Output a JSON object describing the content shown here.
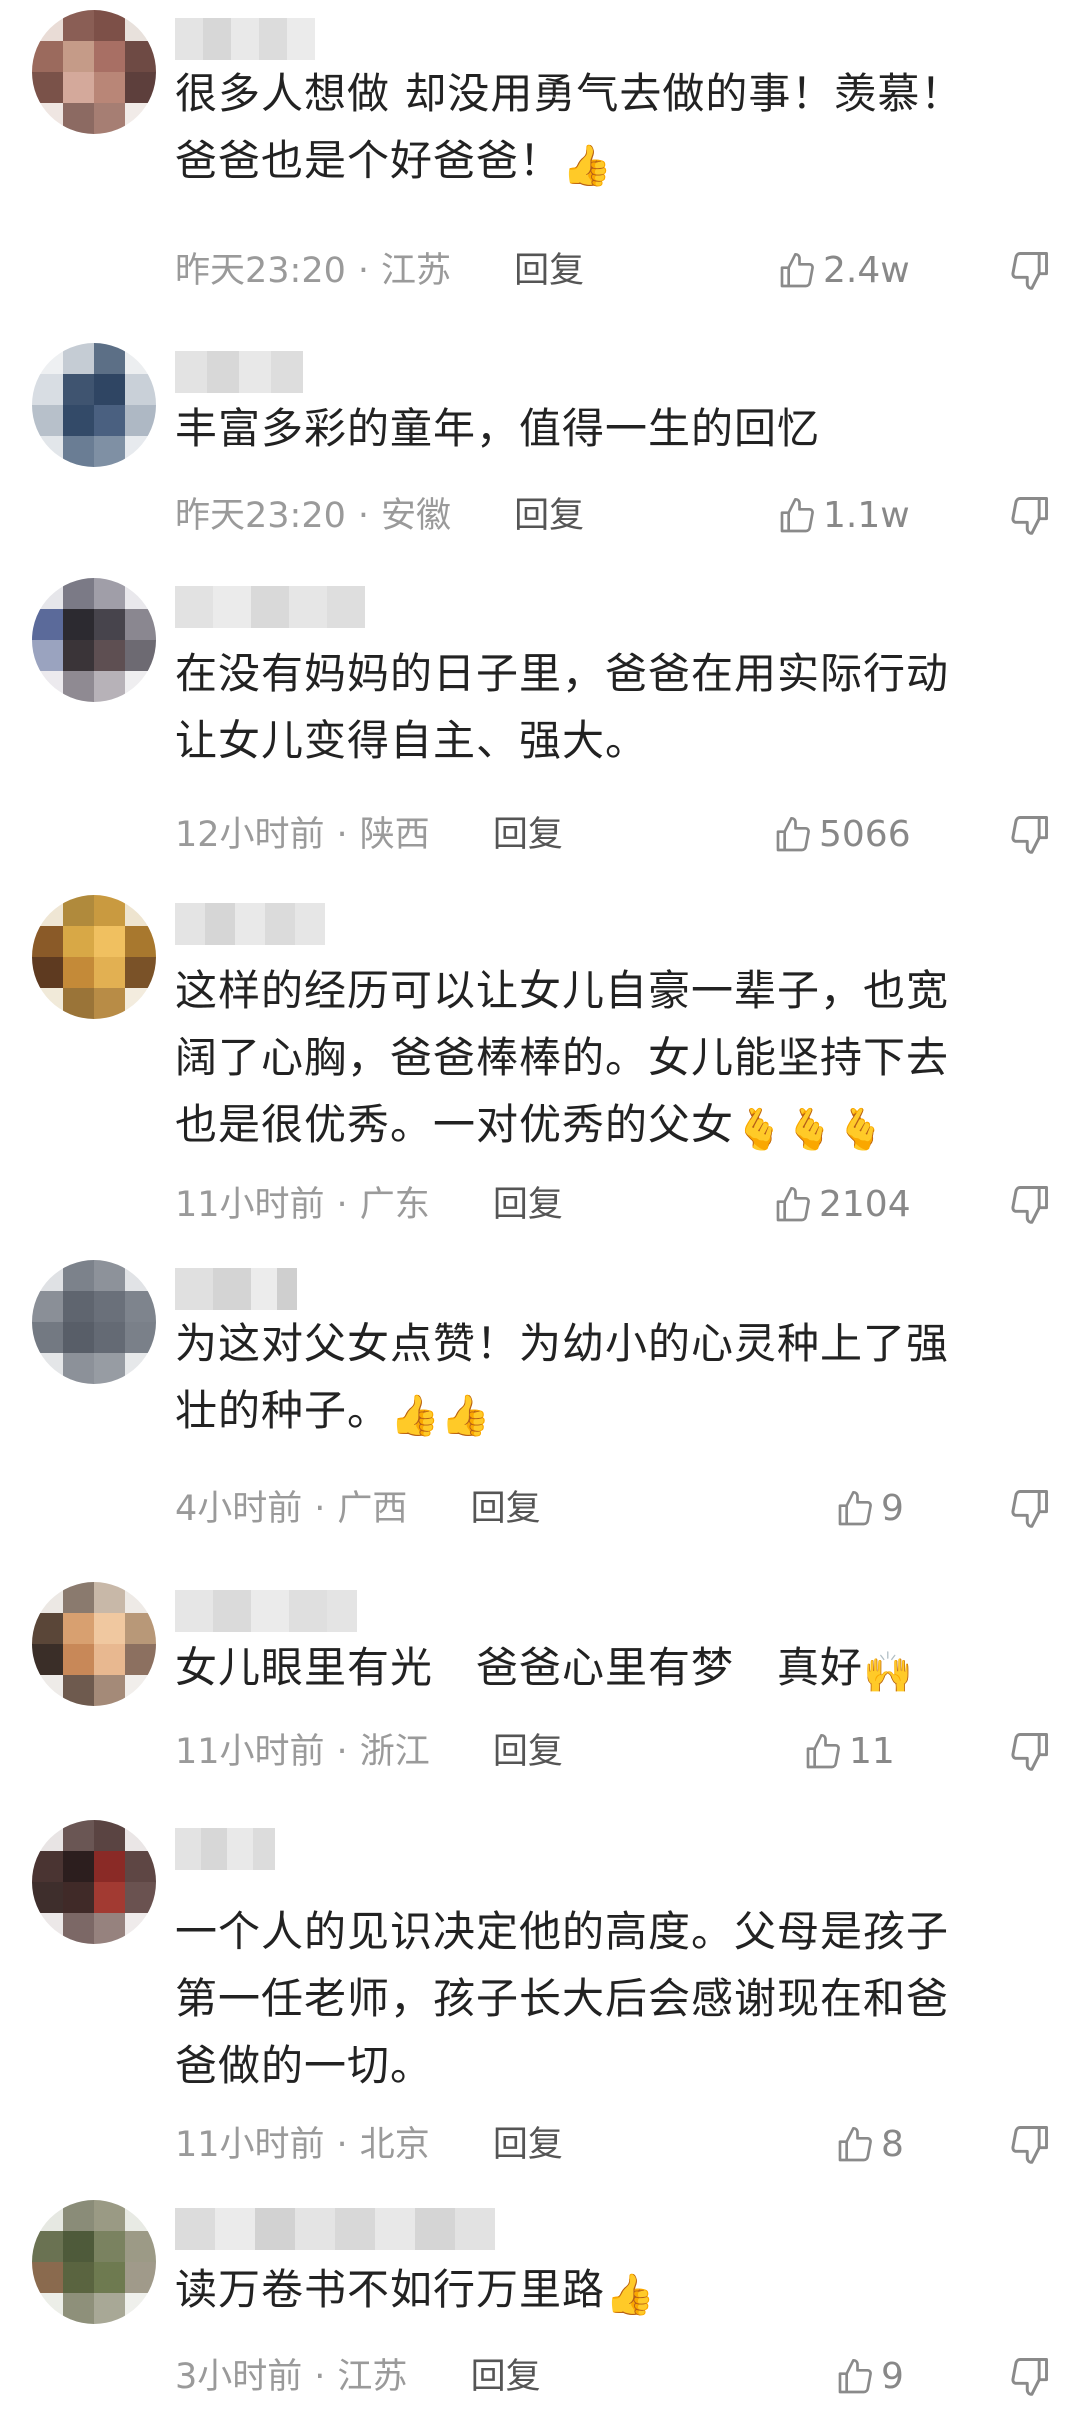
{
  "comments": [
    {
      "text_lines": [
        "很多人想做 却没用勇气去做的事！羡慕！",
        "爸爸也是个好爸爸！"
      ],
      "emoji": "👍",
      "time": "昨天23:20",
      "location": "江苏",
      "reply_label": "回复",
      "likes": "2.4w"
    },
    {
      "text_lines": [
        "丰富多彩的童年，值得一生的回忆"
      ],
      "emoji": "",
      "time": "昨天23:20",
      "location": "安徽",
      "reply_label": "回复",
      "likes": "1.1w"
    },
    {
      "text_lines": [
        "在没有妈妈的日子里，爸爸在用实际行动",
        "让女儿变得自主、强大。"
      ],
      "emoji": "",
      "time": "12小时前",
      "location": "陕西",
      "reply_label": "回复",
      "likes": "5066"
    },
    {
      "text_lines": [
        "这样的经历可以让女儿自豪一辈子，也宽",
        "阔了心胸，爸爸棒棒的。女儿能坚持下去",
        "也是很优秀。一对优秀的父女"
      ],
      "emoji": "🫰🫰🫰",
      "time": "11小时前",
      "location": "广东",
      "reply_label": "回复",
      "likes": "2104"
    },
    {
      "text_lines": [
        "为这对父女点赞！为幼小的心灵种上了强",
        "壮的种子。"
      ],
      "emoji": "👍👍",
      "time": "4小时前",
      "location": "广西",
      "reply_label": "回复",
      "likes": "9"
    },
    {
      "text_lines": [
        "女儿眼里有光　爸爸心里有梦　真好"
      ],
      "emoji": "🙌",
      "time": "11小时前",
      "location": "浙江",
      "reply_label": "回复",
      "likes": "11"
    },
    {
      "text_lines": [
        "一个人的见识决定他的高度。父母是孩子",
        "第一任老师，孩子长大后会感谢现在和爸",
        "爸做的一切。"
      ],
      "emoji": "",
      "time": "11小时前",
      "location": "北京",
      "reply_label": "回复",
      "likes": "8"
    },
    {
      "text_lines": [
        "读万卷书不如行万里路"
      ],
      "emoji": "👍",
      "time": "3小时前",
      "location": "江苏",
      "reply_label": "回复",
      "likes": "9"
    }
  ],
  "colors": {
    "text": "#222222",
    "meta": "#9a9a9a",
    "reply": "#555555",
    "icon": "#8a8a8a"
  },
  "icons": {
    "like": "thumbs-up-outline-icon",
    "dislike": "thumbs-down-outline-icon"
  }
}
